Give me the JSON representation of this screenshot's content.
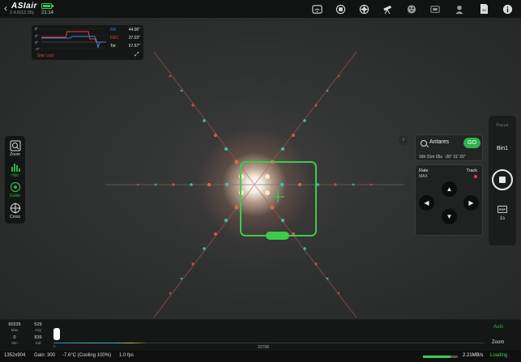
{
  "app": {
    "logo": "ASIair",
    "version": "2.4.6(12.35)",
    "time": "21:14",
    "battery_level": 0.8
  },
  "top_icons": [
    "wifi-icon",
    "camera-icon",
    "aperture-icon",
    "telescope-icon",
    "filter-wheel-icon",
    "focuser-icon",
    "guide-camera-icon",
    "sd-card-icon",
    "info-icon"
  ],
  "guide_graph": {
    "y_labels": [
      "8\"",
      "4\"",
      "0\"",
      "-4\"",
      "-8\""
    ],
    "rows": [
      {
        "key": "RA",
        "value": "44.06\"",
        "color": "#3d7fe0"
      },
      {
        "key": "DEC",
        "value": "37.03\"",
        "color": "#e8453c"
      },
      {
        "key": "Tot",
        "value": "57.57\"",
        "color": "#e8e8e8"
      }
    ],
    "status": "Star Lost"
  },
  "left_toolbar": {
    "items": [
      {
        "label": "Zoom",
        "icon": "zoom-icon",
        "active": false
      },
      {
        "label": "Hist",
        "icon": "histogram-icon",
        "active": true
      },
      {
        "label": "Guide",
        "icon": "guide-icon",
        "active": true
      },
      {
        "label": "Cross",
        "icon": "crosshair-icon",
        "active": false
      }
    ]
  },
  "goto": {
    "target": "Antares",
    "go_label": "GO",
    "ra": "16h 31m 05s",
    "dec": "-26° 31' 20\""
  },
  "mount": {
    "rate_label": "Rate",
    "rate_value": "MAX",
    "track_label": "Track"
  },
  "right_bar": {
    "focus_label": "Focus",
    "bin_label": "Bin1",
    "exp_icon_label": "EXP",
    "exposure": "1s"
  },
  "histogram": {
    "max_value": "65535",
    "max_label": "Max",
    "avg_value": "529",
    "avg_label": "Avg",
    "min_value": "0",
    "min_label": "Min",
    "std_value": "839",
    "std_label": "Std",
    "scale_start": "0",
    "scale_mid": "32768",
    "auto_label": "Auto",
    "zoom_label": "Zoom"
  },
  "status": {
    "resolution": "1352x904",
    "gain": "Gain: 300",
    "temperature": "-7.6°C (Cooling 100%)",
    "fps": "1.0 fps",
    "transfer_rate": "2.21MB/s",
    "loading": "Loading",
    "progress": 0.78
  },
  "colors": {
    "accent_green": "#2fb24a",
    "alert_red": "#e8453c",
    "ra_blue": "#3d7fe0"
  }
}
